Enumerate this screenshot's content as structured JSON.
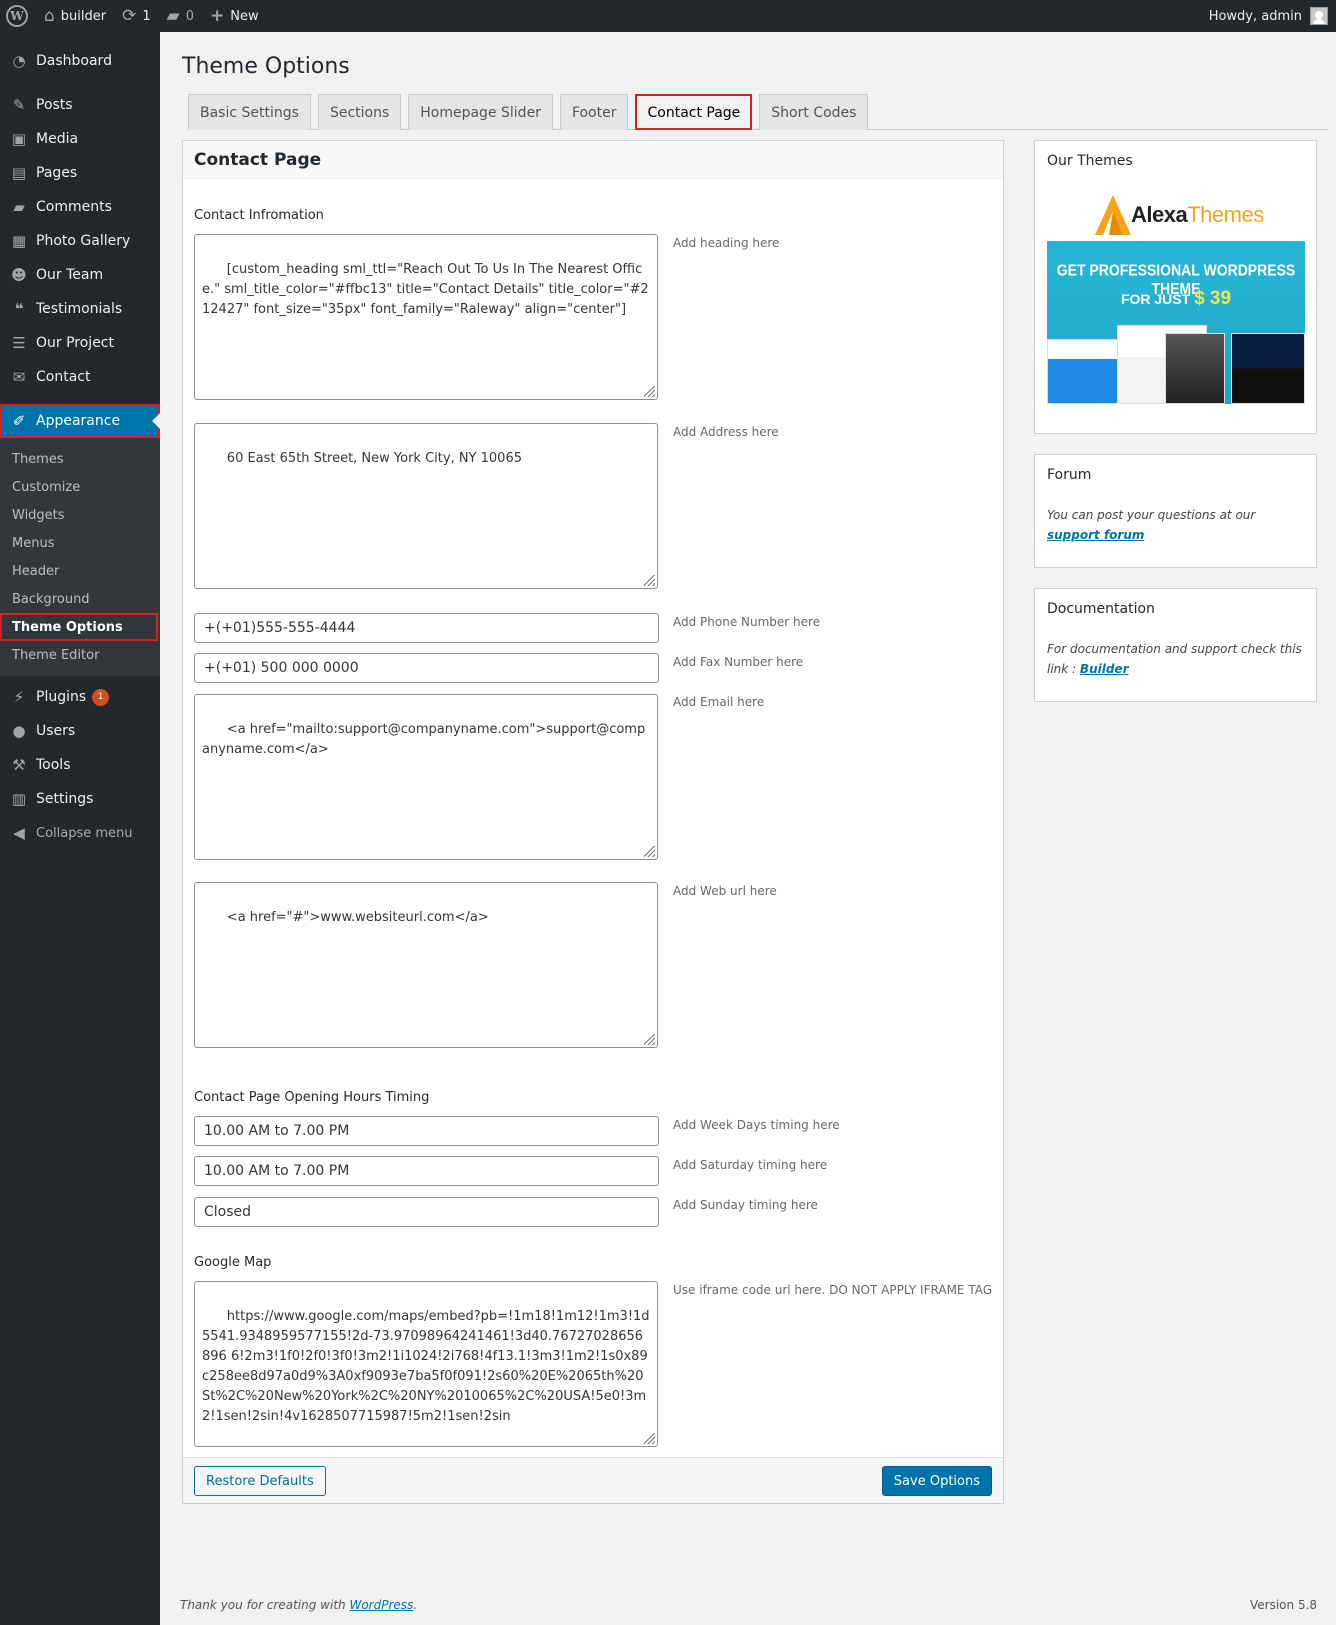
{
  "adminbar": {
    "site_name": "builder",
    "updates_count": "1",
    "comments_count": "0",
    "new_label": "New",
    "greeting": "Howdy, admin"
  },
  "sidebar": {
    "items": [
      {
        "label": "Dashboard",
        "icon": "dashboard-icon"
      },
      {
        "label": "Posts",
        "icon": "pin-icon"
      },
      {
        "label": "Media",
        "icon": "media-icon"
      },
      {
        "label": "Pages",
        "icon": "pages-icon"
      },
      {
        "label": "Comments",
        "icon": "comment-icon"
      },
      {
        "label": "Photo Gallery",
        "icon": "gallery-icon"
      },
      {
        "label": "Our Team",
        "icon": "team-icon"
      },
      {
        "label": "Testimonials",
        "icon": "quote-icon"
      },
      {
        "label": "Our Project",
        "icon": "list-icon"
      },
      {
        "label": "Contact",
        "icon": "mail-icon"
      },
      {
        "label": "Appearance",
        "icon": "brush-icon"
      }
    ],
    "submenu": [
      "Themes",
      "Customize",
      "Widgets",
      "Menus",
      "Header",
      "Background",
      "Theme Options",
      "Theme Editor"
    ],
    "lower_items": [
      {
        "label": "Plugins",
        "icon": "plugin-icon",
        "badge": "1"
      },
      {
        "label": "Users",
        "icon": "user-icon"
      },
      {
        "label": "Tools",
        "icon": "wrench-icon"
      },
      {
        "label": "Settings",
        "icon": "settings-icon"
      }
    ],
    "collapse_label": "Collapse menu"
  },
  "page": {
    "title": "Theme Options",
    "tabs": [
      "Basic Settings",
      "Sections",
      "Homepage Slider",
      "Footer",
      "Contact Page",
      "Short Codes"
    ],
    "active_tab": "Contact Page"
  },
  "panel": {
    "heading": "Contact Page",
    "contact_info_label": "Contact Infromation",
    "heading_field": "[custom_heading sml_ttl=\"Reach Out To Us In The Nearest Office.\" sml_title_color=\"#ffbc13\" title=\"Contact Details\" title_color=\"#212427\" font_size=\"35px\" font_family=\"Raleway\" align=\"center\"]",
    "heading_hint": "Add heading here",
    "address_field": "60 East 65th Street, New York City, NY 10065",
    "address_hint": "Add Address here",
    "phone_field": "+(+01)555-555-4444",
    "phone_hint": "Add Phone Number here",
    "fax_field": "+(+01) 500 000 0000",
    "fax_hint": "Add Fax Number here",
    "email_field": "<a href=\"mailto:support@companyname.com\">support@companyname.com</a>",
    "email_hint": "Add Email here",
    "web_field": "<a href=\"#\">www.websiteurl.com</a>",
    "web_hint": "Add Web url here",
    "hours_label": "Contact Page Opening Hours Timing",
    "weekday_field": "10.00 AM to 7.00 PM",
    "weekday_hint": "Add Week Days timing here",
    "saturday_field": "10.00 AM to 7.00 PM",
    "saturday_hint": "Add Saturday timing here",
    "sunday_field": "Closed",
    "sunday_hint": "Add Sunday timing here",
    "map_label": "Google Map",
    "map_field": "https://www.google.com/maps/embed?pb=!1m18!1m12!1m3!1d5541.9348959577155!2d-73.97098964241461!3d40.76727028656896 6!2m3!1f0!2f0!3f0!3m2!1i1024!2i768!4f13.1!3m3!1m2!1s0x89c258ee8d97a0d9%3A0xf9093e7ba5f0f091!2s60%20E%2065th%20St%2C%20New%20York%2C%20NY%2010065%2C%20USA!5e0!3m2!1sen!2sin!4v1628507715987!5m2!1sen!2sin",
    "map_hint": "Use iframe code url here. DO NOT APPLY IFRAME TAG",
    "restore_label": "Restore Defaults",
    "save_label": "Save Options"
  },
  "side": {
    "themes_title": "Our Themes",
    "ad_logo_a": "Alexa",
    "ad_logo_b": "Themes",
    "ad_line1": "GET PROFESSIONAL WORDPRESS THEME",
    "ad_line2": "FOR JUST",
    "ad_price": "$ 39",
    "forum_title": "Forum",
    "forum_text": "You can post your questions at our",
    "forum_link": "support forum",
    "doc_title": "Documentation",
    "doc_text": "For documentation and support check this link :",
    "doc_link": "Builder"
  },
  "footer": {
    "thanks": "Thank you for creating with",
    "wp_link": "WordPress",
    "version": "Version 5.8"
  },
  "colors": {
    "accent": "#0073aa",
    "highlight": "#d32020",
    "sidebar_bg": "#23282d"
  }
}
